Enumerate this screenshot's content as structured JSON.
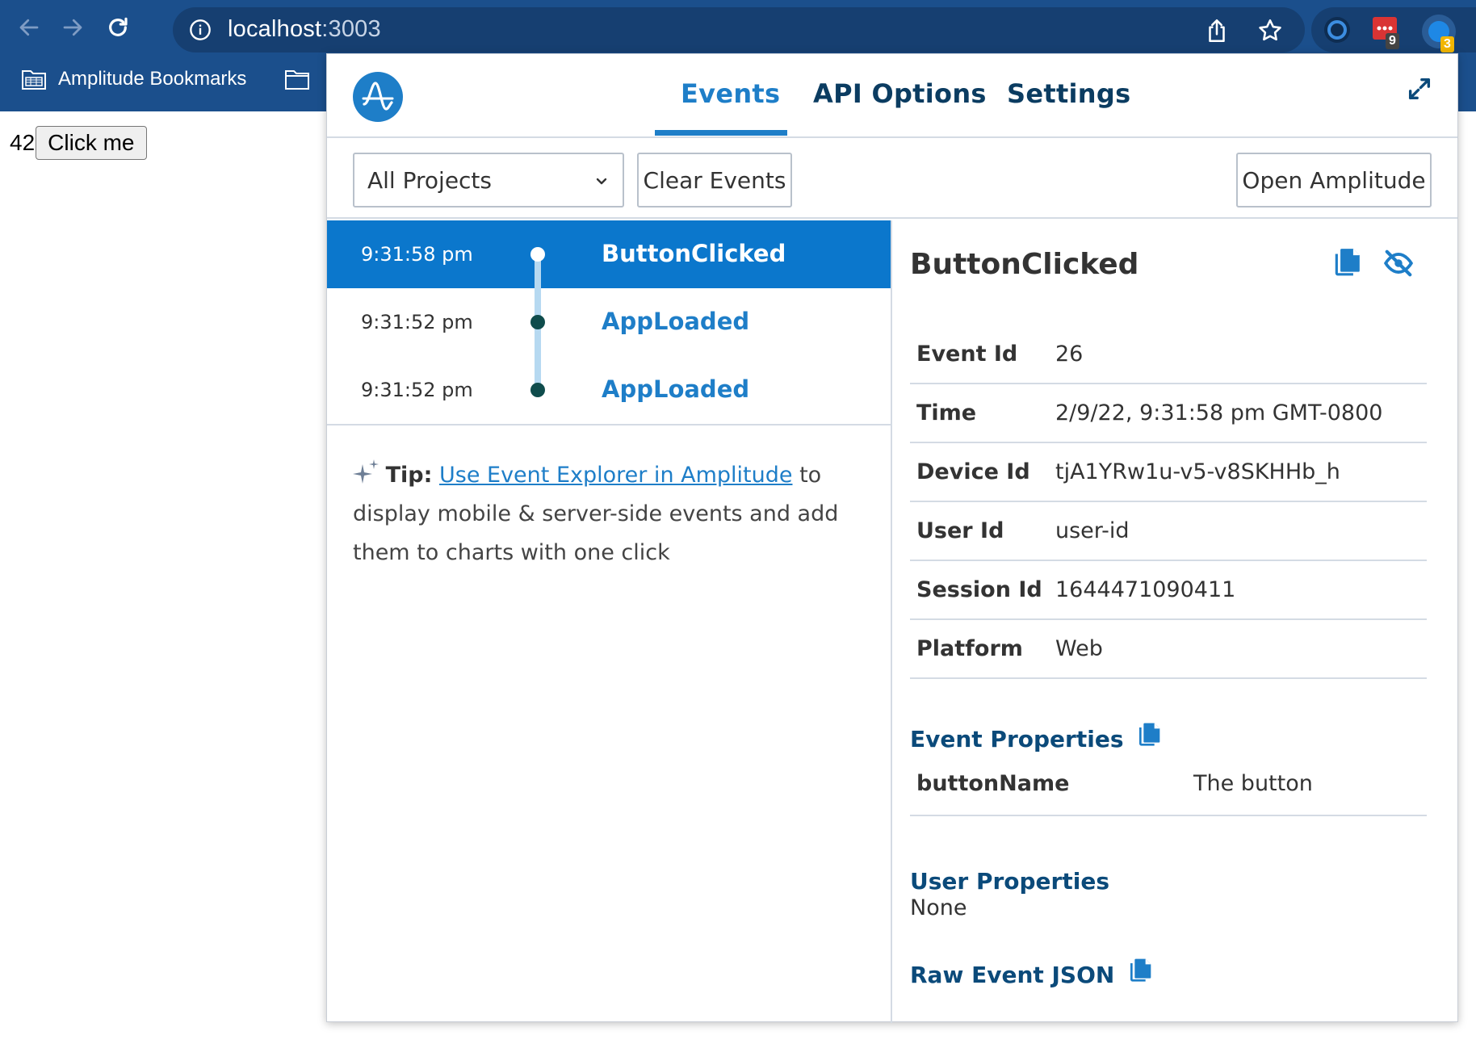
{
  "browser": {
    "url_host": "localhost",
    "url_port": ":3003",
    "extensions": [
      {
        "name": "extension-blue-circle",
        "badge": ""
      },
      {
        "name": "extension-red-dots",
        "badge": "9"
      },
      {
        "name": "extension-amplitude",
        "badge": "3"
      }
    ],
    "bookmarks": [
      {
        "label": "Amplitude Bookmarks"
      },
      {
        "label": ""
      }
    ]
  },
  "page": {
    "counter": "42",
    "button_label": "Click me"
  },
  "popup": {
    "tabs": [
      {
        "label": "Events",
        "active": true
      },
      {
        "label": "API Options",
        "active": false
      },
      {
        "label": "Settings",
        "active": false
      }
    ],
    "toolbar": {
      "project_select": "All Projects",
      "clear_label": "Clear Events",
      "open_label": "Open Amplitude"
    },
    "events": [
      {
        "time": "9:31:58 pm",
        "name": "ButtonClicked",
        "selected": true
      },
      {
        "time": "9:31:52 pm",
        "name": "AppLoaded",
        "selected": false
      },
      {
        "time": "9:31:52 pm",
        "name": "AppLoaded",
        "selected": false
      }
    ],
    "tip": {
      "label": "Tip:",
      "link": "Use Event Explorer in Amplitude",
      "text": " to display mobile & server-side events and add them to charts with one click"
    },
    "detail": {
      "title": "ButtonClicked",
      "fields": [
        {
          "key": "Event Id",
          "value": "26"
        },
        {
          "key": "Time",
          "value": "2/9/22, 9:31:58 pm GMT-0800"
        },
        {
          "key": "Device Id",
          "value": "tjA1YRw1u-v5-v8SKHHb_h"
        },
        {
          "key": "User Id",
          "value": "user-id"
        },
        {
          "key": "Session Id",
          "value": "1644471090411"
        },
        {
          "key": "Platform",
          "value": "Web"
        }
      ],
      "event_properties_title": "Event Properties",
      "event_properties": [
        {
          "key": "buttonName",
          "value": "The button"
        }
      ],
      "user_properties_title": "User Properties",
      "user_properties_value": "None",
      "raw_json_title": "Raw Event JSON"
    },
    "colors": {
      "accent": "#1e7ec8",
      "selected_row": "#0b77cc",
      "heading": "#0b4a7a",
      "chrome": "#1b4f8c"
    }
  }
}
